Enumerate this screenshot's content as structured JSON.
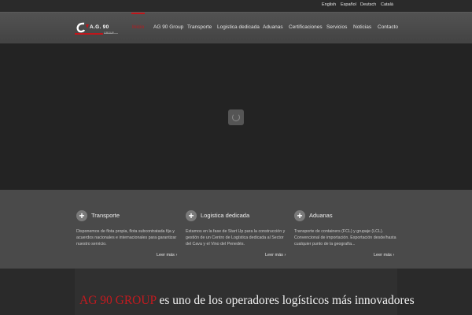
{
  "languages": [
    "English",
    "Español",
    "Deutsch",
    "Català"
  ],
  "logo": {
    "text": "A.G. 90",
    "subtext": "GROUP"
  },
  "nav": [
    {
      "label": "Inicio",
      "active": true
    },
    {
      "label": "AG 90 Group"
    },
    {
      "label": "Transporte"
    },
    {
      "label": "Logistica dedicada"
    },
    {
      "label": "Aduanas"
    },
    {
      "label": "Certificaciones"
    },
    {
      "label": "Servicios"
    },
    {
      "label": "Noticias"
    },
    {
      "label": "Contacto"
    }
  ],
  "hero": {
    "loader_icon": "spinner-icon"
  },
  "features": [
    {
      "title": "Transporte",
      "icon": "plus-icon",
      "text": "Disponemos de flota propia, flota subcontratada fija y acuerdos nacionales e internacionales para garantizar nuestro servicio.",
      "link": "Leer más ›"
    },
    {
      "title": "Logistica dedicada",
      "icon": "plus-icon",
      "text": "Estamos en la fase de Start Up para la construcción y gestión de un Centro de Logística dedicada al Sector del Cava y el Vino del Penedès.",
      "link": "Leer más ›"
    },
    {
      "title": "Aduanas",
      "icon": "plus-icon",
      "text": "Transporte de containers (FCL) y grupaje (LCL). Convencional de importación. Exportación desde/hasta cualquier punto de la geografía...",
      "link": "Leer más ›"
    }
  ],
  "headline": {
    "brand": "AG 90 GROUP",
    "rest": " es uno de los operadores logísticos más innovadores"
  },
  "colors": {
    "accent": "#c0161b",
    "nav_bg": "#4b4b4b",
    "hero_bg": "#232323",
    "features_bg": "#4a4a4a"
  }
}
